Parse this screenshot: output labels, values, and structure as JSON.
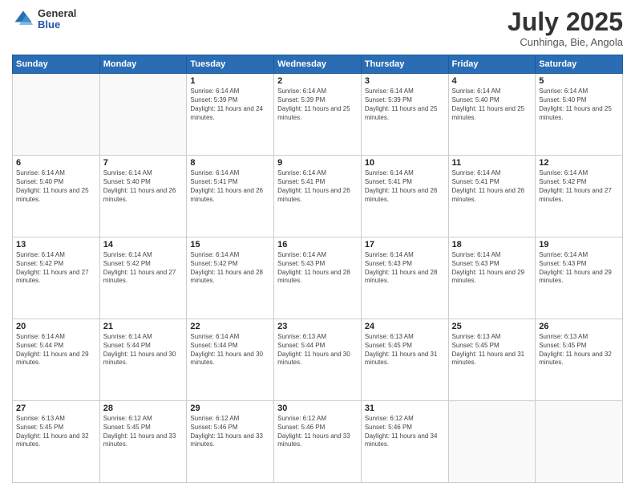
{
  "logo": {
    "general": "General",
    "blue": "Blue"
  },
  "title": "July 2025",
  "subtitle": "Cunhinga, Bie, Angola",
  "headers": [
    "Sunday",
    "Monday",
    "Tuesday",
    "Wednesday",
    "Thursday",
    "Friday",
    "Saturday"
  ],
  "weeks": [
    [
      {
        "day": "",
        "sunrise": "",
        "sunset": "",
        "daylight": ""
      },
      {
        "day": "",
        "sunrise": "",
        "sunset": "",
        "daylight": ""
      },
      {
        "day": "1",
        "sunrise": "Sunrise: 6:14 AM",
        "sunset": "Sunset: 5:39 PM",
        "daylight": "Daylight: 11 hours and 24 minutes."
      },
      {
        "day": "2",
        "sunrise": "Sunrise: 6:14 AM",
        "sunset": "Sunset: 5:39 PM",
        "daylight": "Daylight: 11 hours and 25 minutes."
      },
      {
        "day": "3",
        "sunrise": "Sunrise: 6:14 AM",
        "sunset": "Sunset: 5:39 PM",
        "daylight": "Daylight: 11 hours and 25 minutes."
      },
      {
        "day": "4",
        "sunrise": "Sunrise: 6:14 AM",
        "sunset": "Sunset: 5:40 PM",
        "daylight": "Daylight: 11 hours and 25 minutes."
      },
      {
        "day": "5",
        "sunrise": "Sunrise: 6:14 AM",
        "sunset": "Sunset: 5:40 PM",
        "daylight": "Daylight: 11 hours and 25 minutes."
      }
    ],
    [
      {
        "day": "6",
        "sunrise": "Sunrise: 6:14 AM",
        "sunset": "Sunset: 5:40 PM",
        "daylight": "Daylight: 11 hours and 25 minutes."
      },
      {
        "day": "7",
        "sunrise": "Sunrise: 6:14 AM",
        "sunset": "Sunset: 5:40 PM",
        "daylight": "Daylight: 11 hours and 26 minutes."
      },
      {
        "day": "8",
        "sunrise": "Sunrise: 6:14 AM",
        "sunset": "Sunset: 5:41 PM",
        "daylight": "Daylight: 11 hours and 26 minutes."
      },
      {
        "day": "9",
        "sunrise": "Sunrise: 6:14 AM",
        "sunset": "Sunset: 5:41 PM",
        "daylight": "Daylight: 11 hours and 26 minutes."
      },
      {
        "day": "10",
        "sunrise": "Sunrise: 6:14 AM",
        "sunset": "Sunset: 5:41 PM",
        "daylight": "Daylight: 11 hours and 26 minutes."
      },
      {
        "day": "11",
        "sunrise": "Sunrise: 6:14 AM",
        "sunset": "Sunset: 5:41 PM",
        "daylight": "Daylight: 11 hours and 26 minutes."
      },
      {
        "day": "12",
        "sunrise": "Sunrise: 6:14 AM",
        "sunset": "Sunset: 5:42 PM",
        "daylight": "Daylight: 11 hours and 27 minutes."
      }
    ],
    [
      {
        "day": "13",
        "sunrise": "Sunrise: 6:14 AM",
        "sunset": "Sunset: 5:42 PM",
        "daylight": "Daylight: 11 hours and 27 minutes."
      },
      {
        "day": "14",
        "sunrise": "Sunrise: 6:14 AM",
        "sunset": "Sunset: 5:42 PM",
        "daylight": "Daylight: 11 hours and 27 minutes."
      },
      {
        "day": "15",
        "sunrise": "Sunrise: 6:14 AM",
        "sunset": "Sunset: 5:42 PM",
        "daylight": "Daylight: 11 hours and 28 minutes."
      },
      {
        "day": "16",
        "sunrise": "Sunrise: 6:14 AM",
        "sunset": "Sunset: 5:43 PM",
        "daylight": "Daylight: 11 hours and 28 minutes."
      },
      {
        "day": "17",
        "sunrise": "Sunrise: 6:14 AM",
        "sunset": "Sunset: 5:43 PM",
        "daylight": "Daylight: 11 hours and 28 minutes."
      },
      {
        "day": "18",
        "sunrise": "Sunrise: 6:14 AM",
        "sunset": "Sunset: 5:43 PM",
        "daylight": "Daylight: 11 hours and 29 minutes."
      },
      {
        "day": "19",
        "sunrise": "Sunrise: 6:14 AM",
        "sunset": "Sunset: 5:43 PM",
        "daylight": "Daylight: 11 hours and 29 minutes."
      }
    ],
    [
      {
        "day": "20",
        "sunrise": "Sunrise: 6:14 AM",
        "sunset": "Sunset: 5:44 PM",
        "daylight": "Daylight: 11 hours and 29 minutes."
      },
      {
        "day": "21",
        "sunrise": "Sunrise: 6:14 AM",
        "sunset": "Sunset: 5:44 PM",
        "daylight": "Daylight: 11 hours and 30 minutes."
      },
      {
        "day": "22",
        "sunrise": "Sunrise: 6:14 AM",
        "sunset": "Sunset: 5:44 PM",
        "daylight": "Daylight: 11 hours and 30 minutes."
      },
      {
        "day": "23",
        "sunrise": "Sunrise: 6:13 AM",
        "sunset": "Sunset: 5:44 PM",
        "daylight": "Daylight: 11 hours and 30 minutes."
      },
      {
        "day": "24",
        "sunrise": "Sunrise: 6:13 AM",
        "sunset": "Sunset: 5:45 PM",
        "daylight": "Daylight: 11 hours and 31 minutes."
      },
      {
        "day": "25",
        "sunrise": "Sunrise: 6:13 AM",
        "sunset": "Sunset: 5:45 PM",
        "daylight": "Daylight: 11 hours and 31 minutes."
      },
      {
        "day": "26",
        "sunrise": "Sunrise: 6:13 AM",
        "sunset": "Sunset: 5:45 PM",
        "daylight": "Daylight: 11 hours and 32 minutes."
      }
    ],
    [
      {
        "day": "27",
        "sunrise": "Sunrise: 6:13 AM",
        "sunset": "Sunset: 5:45 PM",
        "daylight": "Daylight: 11 hours and 32 minutes."
      },
      {
        "day": "28",
        "sunrise": "Sunrise: 6:12 AM",
        "sunset": "Sunset: 5:45 PM",
        "daylight": "Daylight: 11 hours and 33 minutes."
      },
      {
        "day": "29",
        "sunrise": "Sunrise: 6:12 AM",
        "sunset": "Sunset: 5:46 PM",
        "daylight": "Daylight: 11 hours and 33 minutes."
      },
      {
        "day": "30",
        "sunrise": "Sunrise: 6:12 AM",
        "sunset": "Sunset: 5:46 PM",
        "daylight": "Daylight: 11 hours and 33 minutes."
      },
      {
        "day": "31",
        "sunrise": "Sunrise: 6:12 AM",
        "sunset": "Sunset: 5:46 PM",
        "daylight": "Daylight: 11 hours and 34 minutes."
      },
      {
        "day": "",
        "sunrise": "",
        "sunset": "",
        "daylight": ""
      },
      {
        "day": "",
        "sunrise": "",
        "sunset": "",
        "daylight": ""
      }
    ]
  ]
}
